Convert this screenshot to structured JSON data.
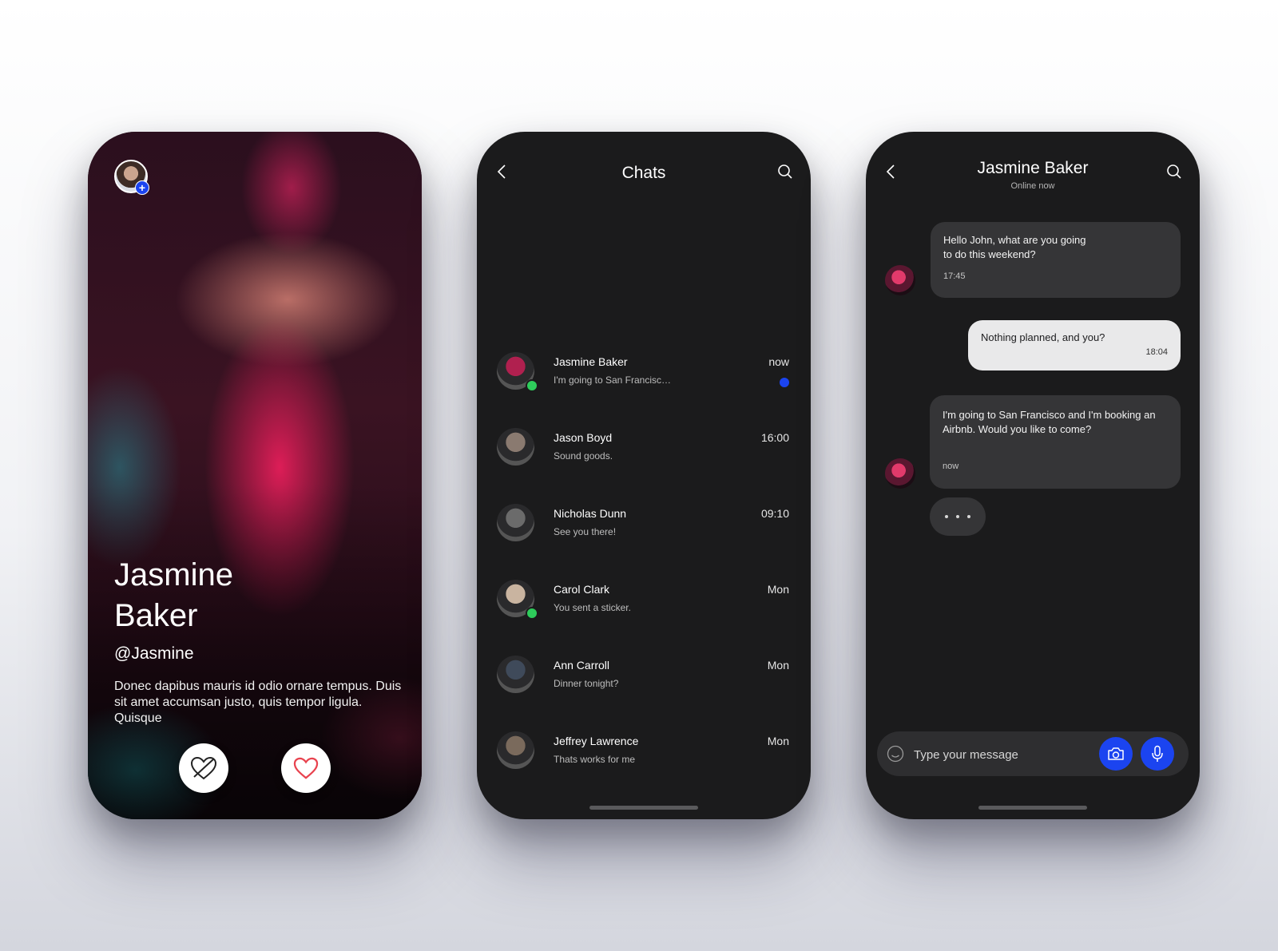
{
  "profile": {
    "name_line1": "Jasmine",
    "name_line2": "Baker",
    "handle": "@Jasmine",
    "bio": "Donec dapibus mauris id odio ornare tempus. Duis sit amet accumsan justo, quis tempor ligula. Quisque",
    "add_badge": "+"
  },
  "chats": {
    "title": "Chats",
    "items": [
      {
        "name": "Jasmine Baker",
        "preview": "I'm going to San Francisco ...",
        "time": "now",
        "online": true,
        "unread": true,
        "avatar_color": "#b0204f"
      },
      {
        "name": "Jason Boyd",
        "preview": "Sound goods.",
        "time": "16:00",
        "online": false,
        "unread": false,
        "avatar_color": "#8a7a70"
      },
      {
        "name": "Nicholas Dunn",
        "preview": "See you there!",
        "time": "09:10",
        "online": false,
        "unread": false,
        "avatar_color": "#6b6b6b"
      },
      {
        "name": "Carol Clark",
        "preview": "You sent a sticker.",
        "time": "Mon",
        "online": true,
        "unread": false,
        "avatar_color": "#c9b4a0"
      },
      {
        "name": "Ann Carroll",
        "preview": "Dinner tonight?",
        "time": "Mon",
        "online": false,
        "unread": false,
        "avatar_color": "#3f4a5a"
      },
      {
        "name": "Jeffrey Lawrence",
        "preview": "Thats works for me",
        "time": "Mon",
        "online": false,
        "unread": false,
        "avatar_color": "#7a6a5c"
      }
    ]
  },
  "conversation": {
    "contact_name": "Jasmine Baker",
    "status": "Online now",
    "messages": [
      {
        "text": "Hello John, what are you going to do this weekend?",
        "time": "17:45",
        "direction": "in"
      },
      {
        "text": "Nothing planned, and you?",
        "time": "18:04",
        "direction": "out"
      },
      {
        "text": "I'm going to San Francisco and I'm booking an Airbnb. Would you like to come?",
        "time": "now",
        "direction": "in"
      }
    ],
    "input_placeholder": "Type your message"
  },
  "colors": {
    "accent": "#1b44f0",
    "online": "#2ecc5b",
    "like": "#e8434f",
    "phone_bg": "#1b1b1c"
  }
}
